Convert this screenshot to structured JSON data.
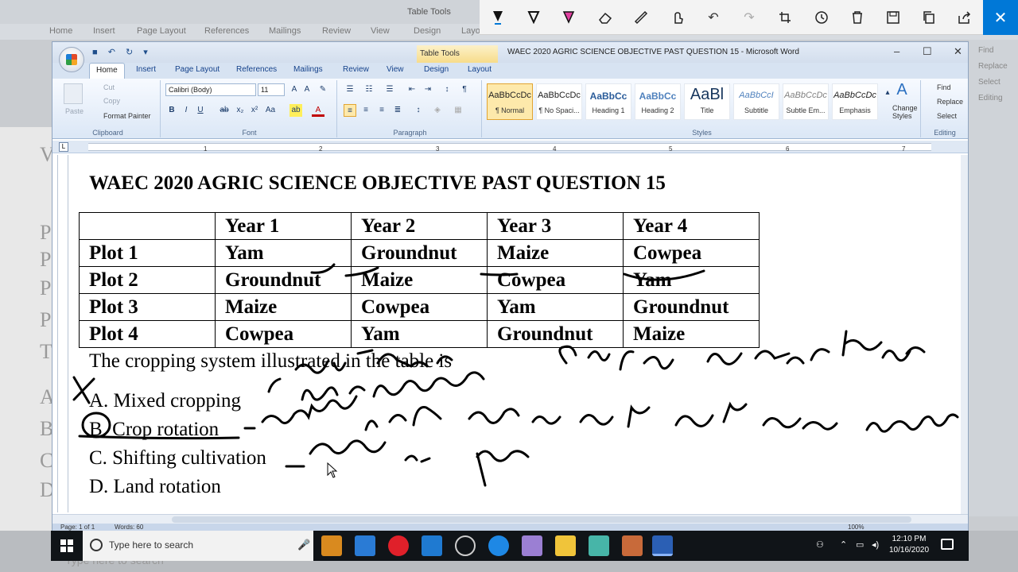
{
  "background": {
    "title": "Table Tools",
    "tabs": [
      "Home",
      "Insert",
      "Page Layout",
      "References",
      "Mailings",
      "Review",
      "View",
      "Design",
      "Layo"
    ],
    "right_labels": [
      "Find",
      "Replace",
      "Select",
      "Editing"
    ],
    "search_placeholder": "Type here to search"
  },
  "pen_toolbar": {
    "icons": [
      "ballpoint-pen-icon",
      "pencil-pen-icon",
      "highlighter-icon",
      "eraser-icon",
      "ruler-icon",
      "touch-writing-icon",
      "undo-icon",
      "redo-icon",
      "crop-icon",
      "history-icon",
      "delete-icon",
      "save-icon",
      "copy-icon",
      "share-icon"
    ],
    "close_label": "✕"
  },
  "word": {
    "title": "WAEC 2020 AGRIC SCIENCE OBJECTIVE PAST QUESTION 15 - Microsoft Word",
    "context_tab": "Table Tools",
    "window_controls": [
      "–",
      "☐",
      "✕"
    ],
    "tabs": [
      "Home",
      "Insert",
      "Page Layout",
      "References",
      "Mailings",
      "Review",
      "View",
      "Design",
      "Layout"
    ],
    "active_tab": "Home",
    "clipboard": {
      "label": "Clipboard",
      "paste": "Paste",
      "cut": "Cut",
      "copy": "Copy",
      "format_painter": "Format Painter"
    },
    "font": {
      "label": "Font",
      "name": "Calibri (Body)",
      "size": "11"
    },
    "paragraph": {
      "label": "Paragraph"
    },
    "styles": {
      "label": "Styles",
      "items": [
        {
          "preview": "AaBbCcDc",
          "name": "¶ Normal"
        },
        {
          "preview": "AaBbCcDc",
          "name": "¶ No Spaci..."
        },
        {
          "preview": "AaBbCc",
          "name": "Heading 1"
        },
        {
          "preview": "AaBbCc",
          "name": "Heading 2"
        },
        {
          "preview": "AaBl",
          "name": "Title"
        },
        {
          "preview": "AaBbCcI",
          "name": "Subtitle"
        },
        {
          "preview": "AaBbCcDc",
          "name": "Subtle Em..."
        },
        {
          "preview": "AaBbCcDc",
          "name": "Emphasis"
        }
      ],
      "change_styles": "Change Styles"
    },
    "editing": {
      "label": "Editing",
      "find": "Find",
      "replace": "Replace",
      "select": "Select"
    },
    "ruler_numbers": [
      "1",
      "2",
      "3",
      "4",
      "5",
      "6",
      "7"
    ],
    "status": {
      "page": "Page: 1 of 1",
      "words": "Words: 60",
      "zoom": "100%"
    }
  },
  "document": {
    "title": "WAEC 2020 AGRIC SCIENCE OBJECTIVE PAST QUESTION 15",
    "table": {
      "headers": [
        "",
        "Year 1",
        "Year 2",
        "Year 3",
        "Year 4"
      ],
      "rows": [
        [
          "Plot 1",
          "Yam",
          "Groundnut",
          "Maize",
          "Cowpea"
        ],
        [
          "Plot 2",
          "Groundnut",
          "Maize",
          "Cowpea",
          "Yam"
        ],
        [
          "Plot 3",
          "Maize",
          "Cowpea",
          "Yam",
          "Groundnut"
        ],
        [
          "Plot 4",
          "Cowpea",
          "Yam",
          "Groundnut",
          "Maize"
        ]
      ]
    },
    "question": "The cropping system illustrated in the table is",
    "options": [
      "A. Mixed cropping",
      "B. Crop rotation",
      "C. Shifting cultivation",
      "D. Land rotation"
    ]
  },
  "taskbar": {
    "search_placeholder": "Type here to search",
    "time": "12:10 PM",
    "date": "10/16/2020"
  }
}
